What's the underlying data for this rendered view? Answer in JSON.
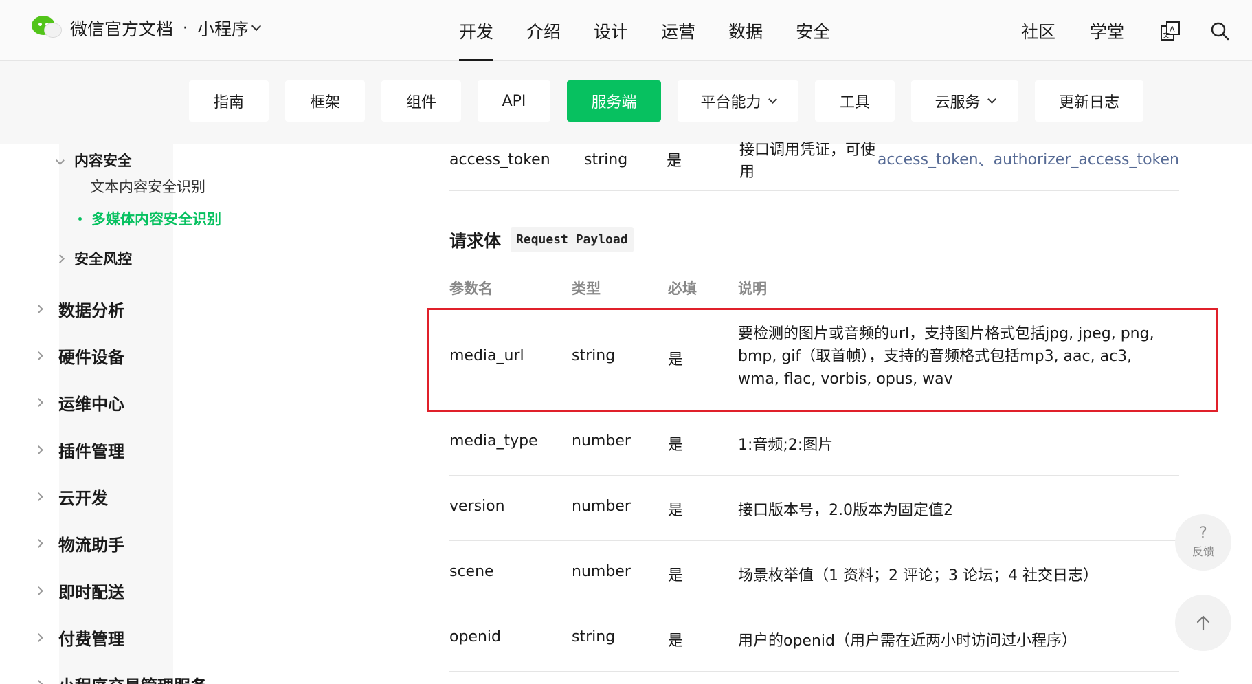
{
  "header": {
    "brand": "微信官方文档",
    "dot": "·",
    "product": "小程序",
    "nav": [
      "开发",
      "介绍",
      "设计",
      "运营",
      "数据",
      "安全"
    ],
    "right_links": [
      "社区",
      "学堂"
    ],
    "translate_icon": "translate-icon",
    "search_icon": "search-icon"
  },
  "subnav": {
    "tabs": [
      {
        "label": "指南",
        "dropdown": false
      },
      {
        "label": "框架",
        "dropdown": false
      },
      {
        "label": "组件",
        "dropdown": false
      },
      {
        "label": "API",
        "dropdown": false
      },
      {
        "label": "服务端",
        "dropdown": false,
        "active": true
      },
      {
        "label": "平台能力",
        "dropdown": true
      },
      {
        "label": "工具",
        "dropdown": false
      },
      {
        "label": "云服务",
        "dropdown": true
      },
      {
        "label": "更新日志",
        "dropdown": false
      }
    ]
  },
  "sidebar": {
    "group": "内容安全",
    "children": [
      "文本内容安全识别",
      "多媒体内容安全识别"
    ],
    "sibling": "安全风控",
    "sections": [
      "数据分析",
      "硬件设备",
      "运维中心",
      "插件管理",
      "云开发",
      "物流助手",
      "即时配送",
      "付费管理",
      "小程序交易管理服务"
    ]
  },
  "main": {
    "top_row": {
      "name": "access_token",
      "type": "string",
      "required": "是",
      "desc_prefix": "接口调用凭证，可使用 ",
      "link1": "access_token",
      "sep": "、",
      "link2": "authorizer_access_token"
    },
    "section": {
      "title": "请求体",
      "code": "Request Payload"
    },
    "columns": [
      "参数名",
      "类型",
      "必填",
      "说明"
    ],
    "rows": [
      {
        "name": "media_url",
        "type": "string",
        "required": "是",
        "desc": "要检测的图片或音频的url，支持图片格式包括jpg, jpeg, png, bmp, gif（取首帧），支持的音频格式包括mp3, aac, ac3, wma, flac, vorbis, opus, wav"
      },
      {
        "name": "media_type",
        "type": "number",
        "required": "是",
        "desc": "1:音频;2:图片"
      },
      {
        "name": "version",
        "type": "number",
        "required": "是",
        "desc": "接口版本号，2.0版本为固定值2"
      },
      {
        "name": "scene",
        "type": "number",
        "required": "是",
        "desc": "场景枚举值（1 资料；2 评论；3 论坛；4 社交日志）"
      },
      {
        "name": "openid",
        "type": "string",
        "required": "是",
        "desc": "用户的openid（用户需在近两小时访问过小程序）"
      }
    ]
  },
  "floating": {
    "feedback_symbol": "?",
    "feedback_label": "反馈"
  },
  "colors": {
    "accent": "#07c160",
    "link": "#576b95",
    "highlight": "#e0202a"
  }
}
